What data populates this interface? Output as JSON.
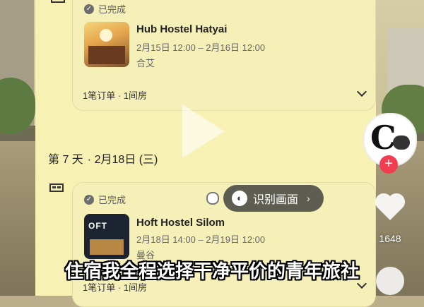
{
  "trip": {
    "stay1": {
      "status": "已完成",
      "hotel_name": "Hub Hostel Hatyai",
      "dates": "2月15日 12:00 – 2月16日 12:00",
      "city": "合艾",
      "orders": "1笔订单 · 1间房"
    },
    "day7": {
      "label": "第 7 天",
      "date": "· 2月18日 (三)"
    },
    "stay2": {
      "status": "已完成",
      "hotel_name": "Hoft Hostel Silom",
      "dates": "2月18日 14:00 – 2月19日 12:00",
      "city": "曼谷",
      "orders": "1笔订单 · 1间房",
      "thumb_sign": "OFT"
    }
  },
  "overlay": {
    "recognize_label": "识别画面"
  },
  "social": {
    "likes": "1648",
    "colors": {
      "follow": "#f23c4f"
    }
  },
  "subtitle": "住宿我全程选择干净平价的青年旅社",
  "icons": [
    "bed-icon",
    "check-icon",
    "chevron-down-icon",
    "recognize-icon",
    "heart-icon",
    "plus-icon",
    "more-icon",
    "play-icon"
  ]
}
